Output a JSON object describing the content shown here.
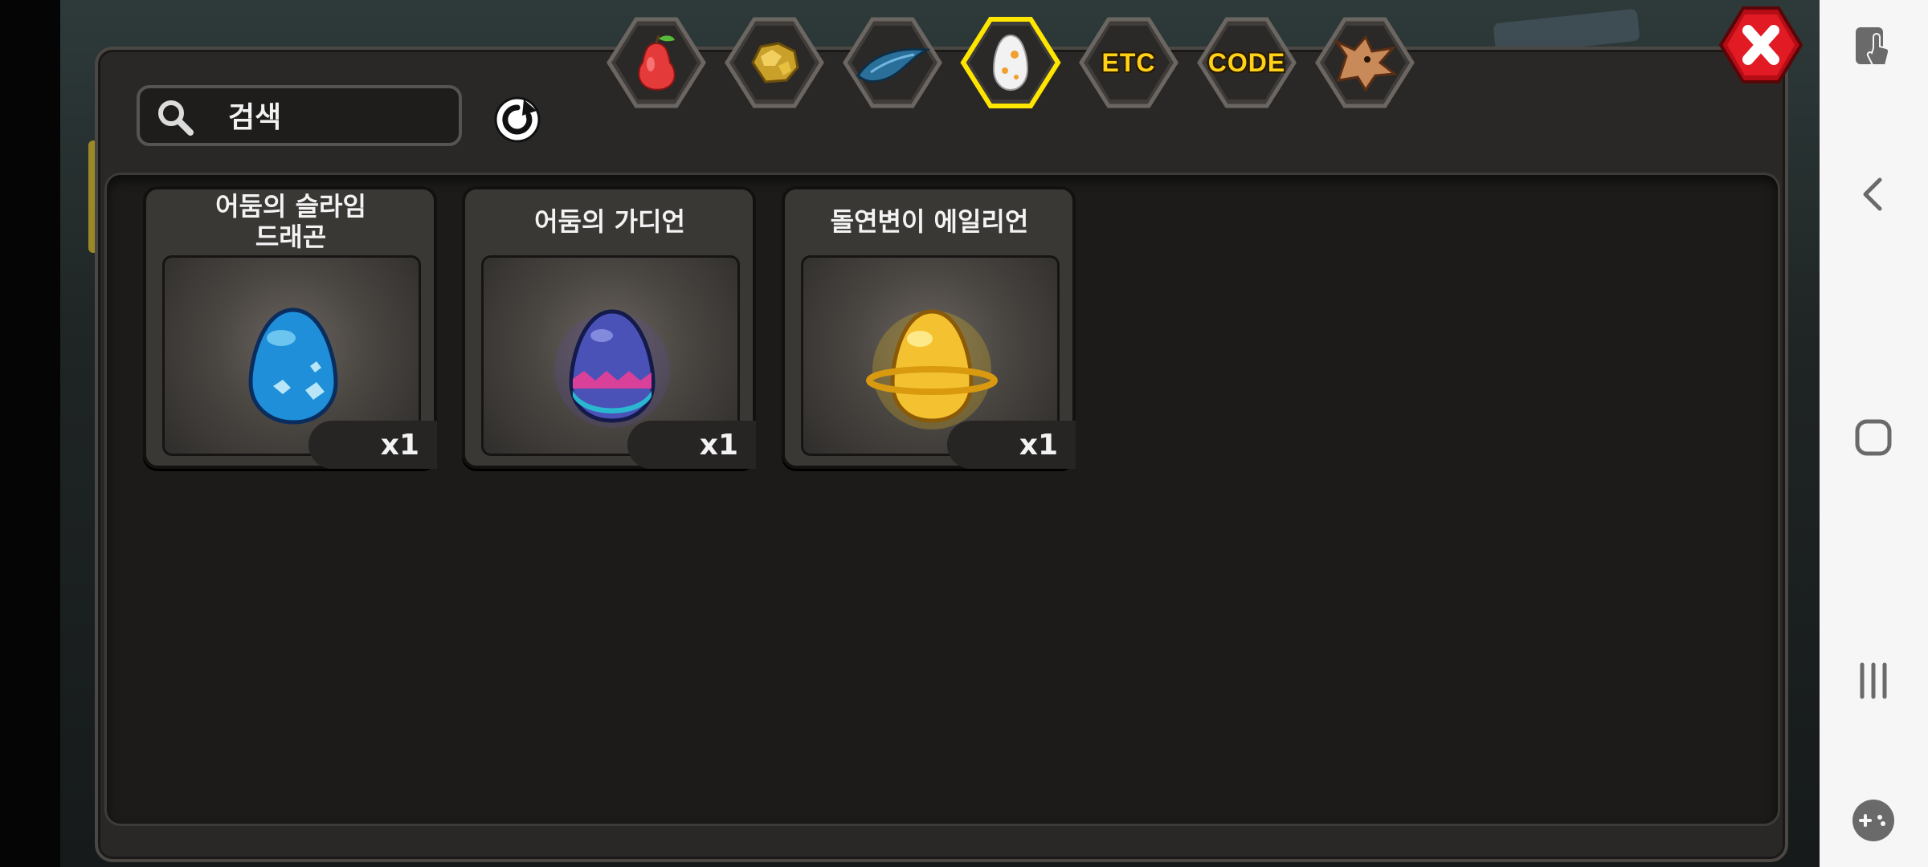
{
  "search": {
    "placeholder": "검색",
    "value": ""
  },
  "tabs": [
    {
      "name": "fruit",
      "icon": "pear-icon",
      "selected": false
    },
    {
      "name": "gold",
      "icon": "gold-ore-icon",
      "selected": false
    },
    {
      "name": "scale",
      "icon": "dragon-scale-icon",
      "selected": false
    },
    {
      "name": "egg",
      "icon": "egg-icon",
      "selected": true
    },
    {
      "name": "etc",
      "label": "ETC",
      "selected": false
    },
    {
      "name": "code",
      "label": "CODE",
      "selected": false
    },
    {
      "name": "dragon",
      "icon": "dragon-head-icon",
      "selected": false
    }
  ],
  "items": [
    {
      "name": "어둠의 슬라임\n드래곤",
      "qty": "x1",
      "egg": "blue-spotted-egg"
    },
    {
      "name": "어둠의 가디언",
      "qty": "x1",
      "egg": "purple-zigzag-egg"
    },
    {
      "name": "돌연변이 에일리언",
      "qty": "x1",
      "egg": "golden-ringed-egg"
    }
  ],
  "colors": {
    "accent_tab_border": "#ffe600",
    "close_red": "#e11a24",
    "panel": "#2a2826"
  }
}
